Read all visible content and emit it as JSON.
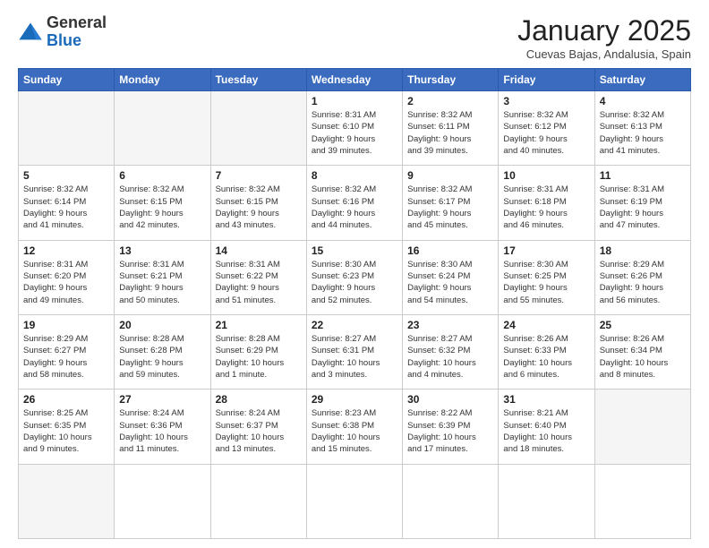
{
  "logo": {
    "general": "General",
    "blue": "Blue"
  },
  "header": {
    "title": "January 2025",
    "subtitle": "Cuevas Bajas, Andalusia, Spain"
  },
  "weekdays": [
    "Sunday",
    "Monday",
    "Tuesday",
    "Wednesday",
    "Thursday",
    "Friday",
    "Saturday"
  ],
  "days": [
    {
      "date": "",
      "info": ""
    },
    {
      "date": "",
      "info": ""
    },
    {
      "date": "",
      "info": ""
    },
    {
      "date": "1",
      "info": "Sunrise: 8:31 AM\nSunset: 6:10 PM\nDaylight: 9 hours\nand 39 minutes."
    },
    {
      "date": "2",
      "info": "Sunrise: 8:32 AM\nSunset: 6:11 PM\nDaylight: 9 hours\nand 39 minutes."
    },
    {
      "date": "3",
      "info": "Sunrise: 8:32 AM\nSunset: 6:12 PM\nDaylight: 9 hours\nand 40 minutes."
    },
    {
      "date": "4",
      "info": "Sunrise: 8:32 AM\nSunset: 6:13 PM\nDaylight: 9 hours\nand 41 minutes."
    },
    {
      "date": "5",
      "info": "Sunrise: 8:32 AM\nSunset: 6:14 PM\nDaylight: 9 hours\nand 41 minutes."
    },
    {
      "date": "6",
      "info": "Sunrise: 8:32 AM\nSunset: 6:15 PM\nDaylight: 9 hours\nand 42 minutes."
    },
    {
      "date": "7",
      "info": "Sunrise: 8:32 AM\nSunset: 6:15 PM\nDaylight: 9 hours\nand 43 minutes."
    },
    {
      "date": "8",
      "info": "Sunrise: 8:32 AM\nSunset: 6:16 PM\nDaylight: 9 hours\nand 44 minutes."
    },
    {
      "date": "9",
      "info": "Sunrise: 8:32 AM\nSunset: 6:17 PM\nDaylight: 9 hours\nand 45 minutes."
    },
    {
      "date": "10",
      "info": "Sunrise: 8:31 AM\nSunset: 6:18 PM\nDaylight: 9 hours\nand 46 minutes."
    },
    {
      "date": "11",
      "info": "Sunrise: 8:31 AM\nSunset: 6:19 PM\nDaylight: 9 hours\nand 47 minutes."
    },
    {
      "date": "12",
      "info": "Sunrise: 8:31 AM\nSunset: 6:20 PM\nDaylight: 9 hours\nand 49 minutes."
    },
    {
      "date": "13",
      "info": "Sunrise: 8:31 AM\nSunset: 6:21 PM\nDaylight: 9 hours\nand 50 minutes."
    },
    {
      "date": "14",
      "info": "Sunrise: 8:31 AM\nSunset: 6:22 PM\nDaylight: 9 hours\nand 51 minutes."
    },
    {
      "date": "15",
      "info": "Sunrise: 8:30 AM\nSunset: 6:23 PM\nDaylight: 9 hours\nand 52 minutes."
    },
    {
      "date": "16",
      "info": "Sunrise: 8:30 AM\nSunset: 6:24 PM\nDaylight: 9 hours\nand 54 minutes."
    },
    {
      "date": "17",
      "info": "Sunrise: 8:30 AM\nSunset: 6:25 PM\nDaylight: 9 hours\nand 55 minutes."
    },
    {
      "date": "18",
      "info": "Sunrise: 8:29 AM\nSunset: 6:26 PM\nDaylight: 9 hours\nand 56 minutes."
    },
    {
      "date": "19",
      "info": "Sunrise: 8:29 AM\nSunset: 6:27 PM\nDaylight: 9 hours\nand 58 minutes."
    },
    {
      "date": "20",
      "info": "Sunrise: 8:28 AM\nSunset: 6:28 PM\nDaylight: 9 hours\nand 59 minutes."
    },
    {
      "date": "21",
      "info": "Sunrise: 8:28 AM\nSunset: 6:29 PM\nDaylight: 10 hours\nand 1 minute."
    },
    {
      "date": "22",
      "info": "Sunrise: 8:27 AM\nSunset: 6:31 PM\nDaylight: 10 hours\nand 3 minutes."
    },
    {
      "date": "23",
      "info": "Sunrise: 8:27 AM\nSunset: 6:32 PM\nDaylight: 10 hours\nand 4 minutes."
    },
    {
      "date": "24",
      "info": "Sunrise: 8:26 AM\nSunset: 6:33 PM\nDaylight: 10 hours\nand 6 minutes."
    },
    {
      "date": "25",
      "info": "Sunrise: 8:26 AM\nSunset: 6:34 PM\nDaylight: 10 hours\nand 8 minutes."
    },
    {
      "date": "26",
      "info": "Sunrise: 8:25 AM\nSunset: 6:35 PM\nDaylight: 10 hours\nand 9 minutes."
    },
    {
      "date": "27",
      "info": "Sunrise: 8:24 AM\nSunset: 6:36 PM\nDaylight: 10 hours\nand 11 minutes."
    },
    {
      "date": "28",
      "info": "Sunrise: 8:24 AM\nSunset: 6:37 PM\nDaylight: 10 hours\nand 13 minutes."
    },
    {
      "date": "29",
      "info": "Sunrise: 8:23 AM\nSunset: 6:38 PM\nDaylight: 10 hours\nand 15 minutes."
    },
    {
      "date": "30",
      "info": "Sunrise: 8:22 AM\nSunset: 6:39 PM\nDaylight: 10 hours\nand 17 minutes."
    },
    {
      "date": "31",
      "info": "Sunrise: 8:21 AM\nSunset: 6:40 PM\nDaylight: 10 hours\nand 18 minutes."
    },
    {
      "date": "",
      "info": ""
    },
    {
      "date": "",
      "info": ""
    }
  ]
}
